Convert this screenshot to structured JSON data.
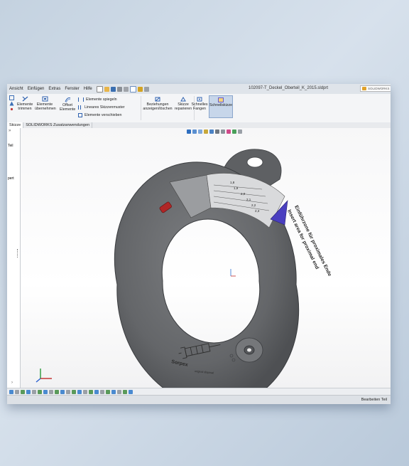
{
  "menu": {
    "items": [
      "Ansicht",
      "Einfügen",
      "Extras",
      "Fenster",
      "Hilfe"
    ]
  },
  "window": {
    "title": "102097-T_Deckel_Oberteil_K_2015.sldprt"
  },
  "search": {
    "label": "SOLIDWORKS"
  },
  "ribbon": {
    "trim_line1": "Elemente",
    "trim_line2": "trimmen",
    "convert_line1": "Elemente",
    "convert_line2": "übernehmen",
    "offset_line1": "Offset",
    "offset_line2": "Elemente",
    "mirror": "Elemente spiegeln",
    "linear_pattern": "Lineares Skizzenmuster",
    "move": "Elemente verschieben",
    "relations_line1": "Beziehungen",
    "relations_line2": "anzeigen/löschen",
    "repair_line1": "Skizze",
    "repair_line2": "reparieren",
    "snaps_line1": "Schnelles",
    "snaps_line2": "Fangen",
    "rapid_sketch": "Schnellskizze"
  },
  "tabs": [
    {
      "label": "Skizze"
    },
    {
      "label": "SOLIDWORKS Zusatzanwendungen"
    }
  ],
  "leftpanel": {
    "label1": "pert",
    "label2": "Teil"
  },
  "part": {
    "scale": [
      "1,8",
      "1,9",
      "2,0",
      "2,1",
      "2,2",
      "2,3"
    ],
    "label_de": "Einführzone für proximales Ende",
    "label_en": "Insert area for proximal end",
    "brand": "Sorpex",
    "brand_sub": "original disposal"
  },
  "status": {
    "text": "Bearbeiten Teil"
  },
  "colors": {
    "part": "#6b6d70",
    "accent": "#4a3fc0",
    "marker": "#b02626"
  }
}
